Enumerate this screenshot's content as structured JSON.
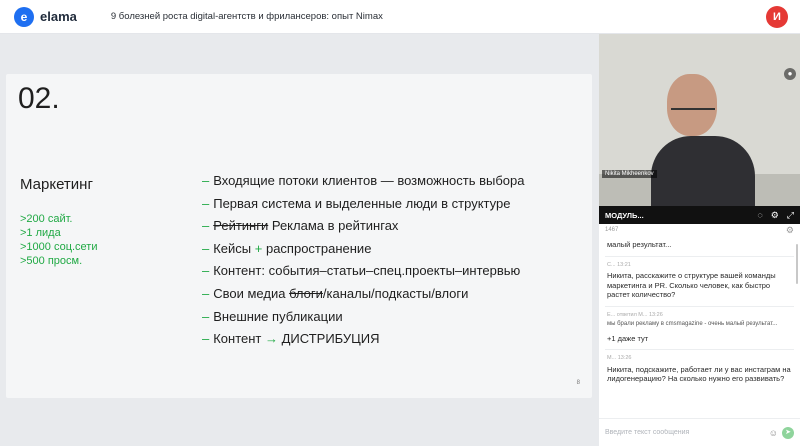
{
  "header": {
    "logo_mark": "e",
    "logo_text": "elama",
    "title": "9 болезней роста digital-агентств и фрилансеров: опыт Nimax",
    "avatar_initial": "И"
  },
  "slide": {
    "number": "02.",
    "left_title": "Маркетинг",
    "stats": [
      ">200 сайт.",
      ">1 лида",
      ">1000 соц.сети",
      ">500 просм."
    ],
    "bullets": [
      {
        "text": "Входящие потоки клиентов — возможность выбора"
      },
      {
        "text": "Первая система и выделенные люди в структуре"
      },
      {
        "strike": "Рейтинги",
        "text": " Реклама в рейтингах"
      },
      {
        "pre": "Кейсы ",
        "green": "+",
        "text": " распространение"
      },
      {
        "text": "Контент: события–статьи–спец.проекты–интервью"
      },
      {
        "pre": "Свои медиа ",
        "strike": "блоги",
        "text": "/каналы/подкасты/влоги"
      },
      {
        "text": "Внешние публикации"
      },
      {
        "pre": "Контент ",
        "green": "→",
        "text": " ДИСТРИБУЦИЯ"
      }
    ],
    "page": "8"
  },
  "video": {
    "speaker_name": "Nikita Mikheenkov",
    "bar_label": "МОДУЛЬ...",
    "icons": [
      "chat-icon",
      "settings-icon",
      "expand-icon"
    ]
  },
  "chat": {
    "header_label": "1467",
    "messages": [
      {
        "meta": "",
        "text": "малый результат..."
      },
      {
        "meta": "С... 13:21",
        "text": "Никита, расскажите о структуре вашей команды маркетинга и PR. Сколько человек, как быстро растет количество?"
      },
      {
        "meta": "Е... ответил М... 13:26",
        "text": "мы брали рекламу в cmsmagazine - очень малый результат...",
        "small": true
      },
      {
        "meta": "",
        "text": "+1 даже тут"
      },
      {
        "meta": "М... 13:26",
        "text": "Никита, подскажите, работает ли у вас инстаграм на лидогенерацию? На сколько нужно его развивать?"
      }
    ],
    "input_placeholder": "Введите текст сообщения"
  },
  "colors": {
    "accent_green": "#20a944",
    "brand_blue": "#1e6ff1",
    "avatar_red": "#e53935"
  }
}
